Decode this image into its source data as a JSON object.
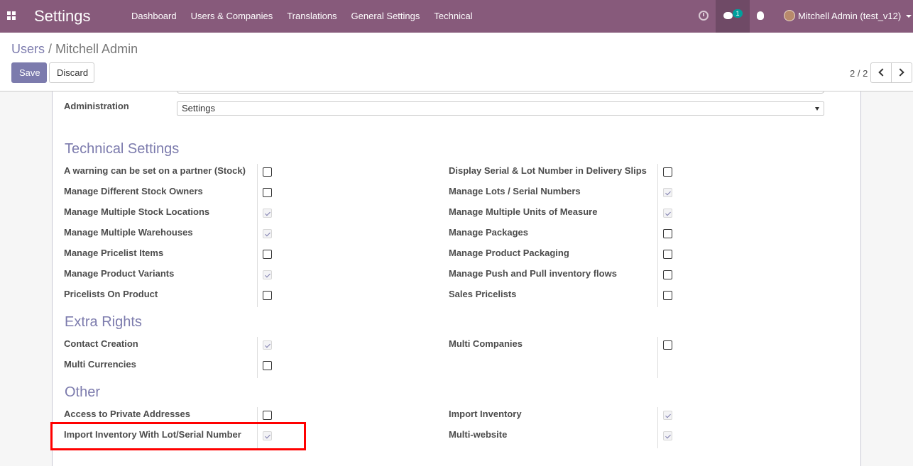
{
  "navbar": {
    "app_title": "Settings",
    "menu": [
      "Dashboard",
      "Users & Companies",
      "Translations",
      "General Settings",
      "Technical"
    ],
    "chat_count": "1",
    "user_name": "Mitchell Admin (test_v12)",
    "brand_color": "#875A7B"
  },
  "breadcrumb": {
    "parent": "Users",
    "current": "Mitchell Admin"
  },
  "actions": {
    "save": "Save",
    "discard": "Discard"
  },
  "pager": {
    "value": "2 / 2"
  },
  "form": {
    "administration_label": "Administration",
    "administration_value": "Settings",
    "sections": [
      {
        "title": "Technical Settings",
        "left": [
          {
            "label": "A warning can be set on a partner (Stock)",
            "checked": false
          },
          {
            "label": "Manage Different Stock Owners",
            "checked": false
          },
          {
            "label": "Manage Multiple Stock Locations",
            "checked": true
          },
          {
            "label": "Manage Multiple Warehouses",
            "checked": true
          },
          {
            "label": "Manage Pricelist Items",
            "checked": false
          },
          {
            "label": "Manage Product Variants",
            "checked": true
          },
          {
            "label": "Pricelists On Product",
            "checked": false
          }
        ],
        "right": [
          {
            "label": "Display Serial & Lot Number in Delivery Slips",
            "checked": false
          },
          {
            "label": "Manage Lots / Serial Numbers",
            "checked": true
          },
          {
            "label": "Manage Multiple Units of Measure",
            "checked": true
          },
          {
            "label": "Manage Packages",
            "checked": false
          },
          {
            "label": "Manage Product Packaging",
            "checked": false
          },
          {
            "label": "Manage Push and Pull inventory flows",
            "checked": false
          },
          {
            "label": "Sales Pricelists",
            "checked": false
          }
        ]
      },
      {
        "title": "Extra Rights",
        "left": [
          {
            "label": "Contact Creation",
            "checked": true
          },
          {
            "label": "Multi Currencies",
            "checked": false
          }
        ],
        "right": [
          {
            "label": "Multi Companies",
            "checked": false
          }
        ]
      },
      {
        "title": "Other",
        "left": [
          {
            "label": "Access to Private Addresses",
            "checked": false
          },
          {
            "label": "Import Inventory With Lot/Serial Number",
            "checked": true
          }
        ],
        "right": [
          {
            "label": "Import Inventory",
            "checked": true
          },
          {
            "label": "Multi-website",
            "checked": true
          }
        ]
      }
    ]
  },
  "highlight_color": "#ff0000"
}
